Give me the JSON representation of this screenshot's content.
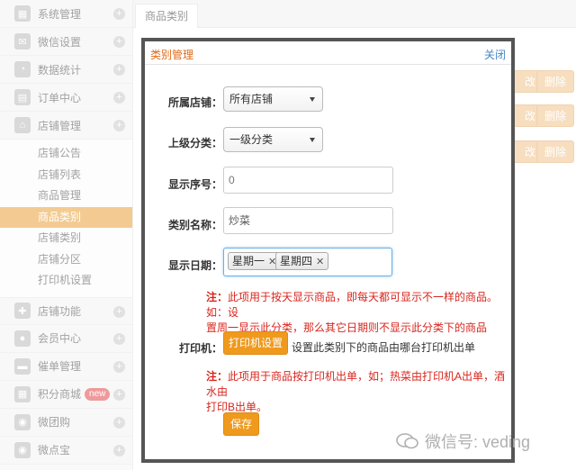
{
  "sidebar": {
    "groups_top": [
      {
        "label": "系统管理",
        "icon": "grid-icon"
      },
      {
        "label": "微信设置",
        "icon": "mail-icon"
      },
      {
        "label": "数据统计",
        "icon": "chart-icon"
      },
      {
        "label": "订单中心",
        "icon": "order-icon"
      },
      {
        "label": "店铺管理",
        "icon": "store-icon"
      }
    ],
    "store_sub": [
      "店铺公告",
      "店铺列表",
      "商品管理",
      "商品类别",
      "店铺类别",
      "店铺分区",
      "打印机设置"
    ],
    "active_sub": "商品类别",
    "groups_bottom": [
      {
        "label": "店铺功能",
        "icon": "puzzle-icon"
      },
      {
        "label": "会员中心",
        "icon": "member-icon"
      },
      {
        "label": "催单管理",
        "icon": "remind-icon"
      },
      {
        "label": "积分商城",
        "icon": "points-icon",
        "badge": "new"
      },
      {
        "label": "微团购",
        "icon": "group-buy-icon"
      },
      {
        "label": "微点宝",
        "icon": "treasure-icon"
      }
    ]
  },
  "main": {
    "tab": "商品类别",
    "bg_buttons": [
      {
        "label": "改"
      },
      {
        "label": "删除"
      },
      {
        "label": "改"
      },
      {
        "label": "删除"
      },
      {
        "label": "改"
      },
      {
        "label": "删除"
      }
    ]
  },
  "modal": {
    "title": "类别管理",
    "close": "关闭",
    "shop_label": "所属店铺：",
    "shop_value": "所有店铺",
    "parent_label": "上级分类：",
    "parent_value": "一级分类",
    "order_label": "显示序号：",
    "order_value": "0",
    "name_label": "类别名称：",
    "name_value": "炒菜",
    "date_label": "显示日期：",
    "date_chips": [
      "星期一",
      "星期四"
    ],
    "note1_prefix": "注：",
    "note1_line1": "此项用于按天显示商品，即每天都可显示不一样的商品。如：设",
    "note1_line2": "置周一显示此分类，那么其它日期则不显示此分类下的商品",
    "printer_label": "打印机：",
    "printer_button": "打印机设置",
    "printer_desc": "设置此类别下的商品由哪台打印机出单",
    "note2_prefix": "注：",
    "note2_line1": "此项用于商品按打印机出单，如；热菜由打印机A出单，酒水由",
    "note2_line2": "打印B出单。",
    "save": "保存"
  },
  "watermark": "微信号: veding",
  "colors": {
    "accent": "#e9a03a",
    "note": "#d8261e",
    "title": "#e06a1a",
    "link": "#4a86c5"
  }
}
